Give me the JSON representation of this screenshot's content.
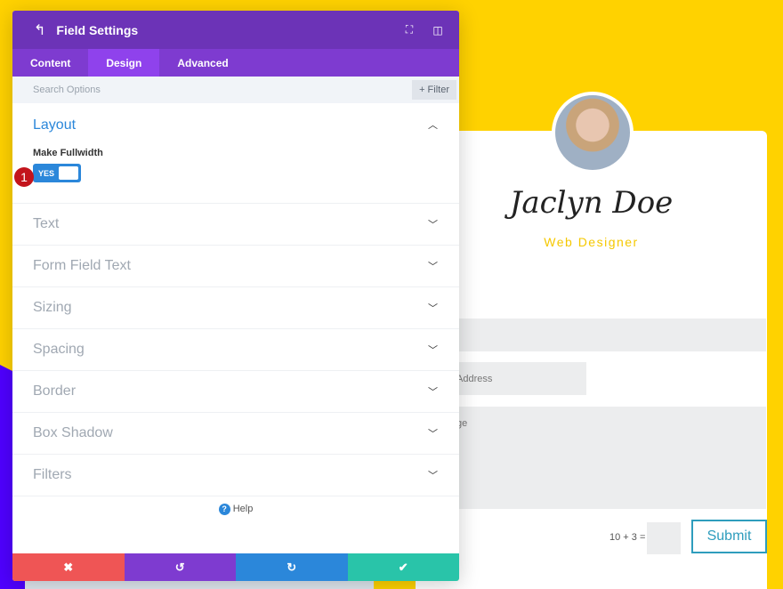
{
  "panel": {
    "title": "Field Settings",
    "tabs": [
      {
        "label": "Content"
      },
      {
        "label": "Design"
      },
      {
        "label": "Advanced"
      }
    ],
    "search_placeholder": "Search Options",
    "filter_label": "+ Filter",
    "layout": {
      "title": "Layout",
      "field_label": "Make Fullwidth",
      "toggle_value": "YES",
      "step_badge": "1"
    },
    "sections": [
      "Text",
      "Form Field Text",
      "Sizing",
      "Spacing",
      "Border",
      "Box Shadow",
      "Filters"
    ],
    "help_label": "Help"
  },
  "preview": {
    "name": "Jaclyn Doe",
    "role": "Web Designer",
    "email_placeholder": "Address",
    "message_placeholder": "ge",
    "captcha": "10 + 3 =",
    "submit_label": "Submit"
  },
  "colors": {
    "header": "#6c33b7",
    "accent": "#2b87da",
    "cancel": "#ef5555",
    "undo": "#7e3bd0",
    "redo": "#2b87da",
    "save": "#29c4a9",
    "background": "#ffd200"
  }
}
